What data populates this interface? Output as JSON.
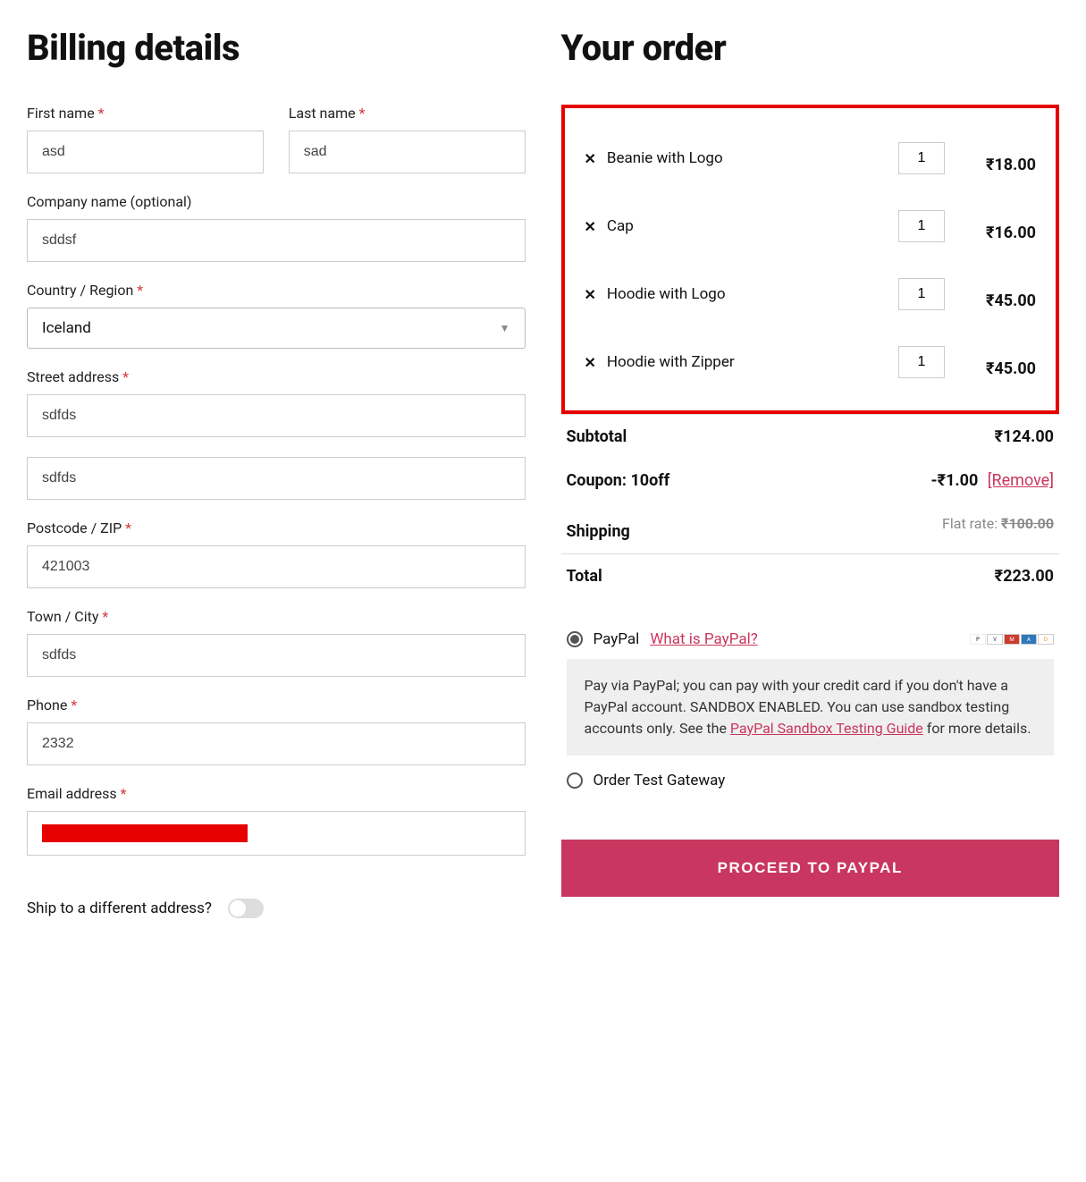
{
  "billing": {
    "title": "Billing details",
    "first_name_label": "First name",
    "first_name": "asd",
    "last_name_label": "Last name",
    "last_name": "sad",
    "company_label": "Company name (optional)",
    "company": "sddsf",
    "country_label": "Country / Region",
    "country": "Iceland",
    "street_label": "Street address",
    "street1": "sdfds",
    "street2": "sdfds",
    "postcode_label": "Postcode / ZIP",
    "postcode": "421003",
    "city_label": "Town / City",
    "city": "sdfds",
    "phone_label": "Phone",
    "phone": "2332",
    "email_label": "Email address",
    "ship_diff_label": "Ship to a different address?"
  },
  "order": {
    "title": "Your order",
    "items": [
      {
        "name": "Beanie with Logo",
        "qty": "1",
        "price": "₹18.00"
      },
      {
        "name": "Cap",
        "qty": "1",
        "price": "₹16.00"
      },
      {
        "name": "Hoodie with Logo",
        "qty": "1",
        "price": "₹45.00"
      },
      {
        "name": "Hoodie with Zipper",
        "qty": "1",
        "price": "₹45.00"
      }
    ],
    "subtotal_label": "Subtotal",
    "subtotal": "₹124.00",
    "coupon_label": "Coupon: 10off",
    "coupon": "-₹1.00",
    "remove_label": "[Remove]",
    "shipping_label": "Shipping",
    "shipping_prefix": "Flat rate: ",
    "shipping_value": "₹100.00",
    "total_label": "Total",
    "total": "₹223.00"
  },
  "payment": {
    "paypal_label": "PayPal",
    "what_is_paypal": "What is PayPal?",
    "paypal_desc_1": "Pay via PayPal; you can pay with your credit card if you don't have a PayPal account. SANDBOX ENABLED. You can use sandbox testing accounts only. See the ",
    "paypal_link": "PayPal Sandbox Testing Guide",
    "paypal_desc_2": " for more details.",
    "test_gateway_label": "Order Test Gateway",
    "proceed_label": "PROCEED TO PAYPAL"
  }
}
